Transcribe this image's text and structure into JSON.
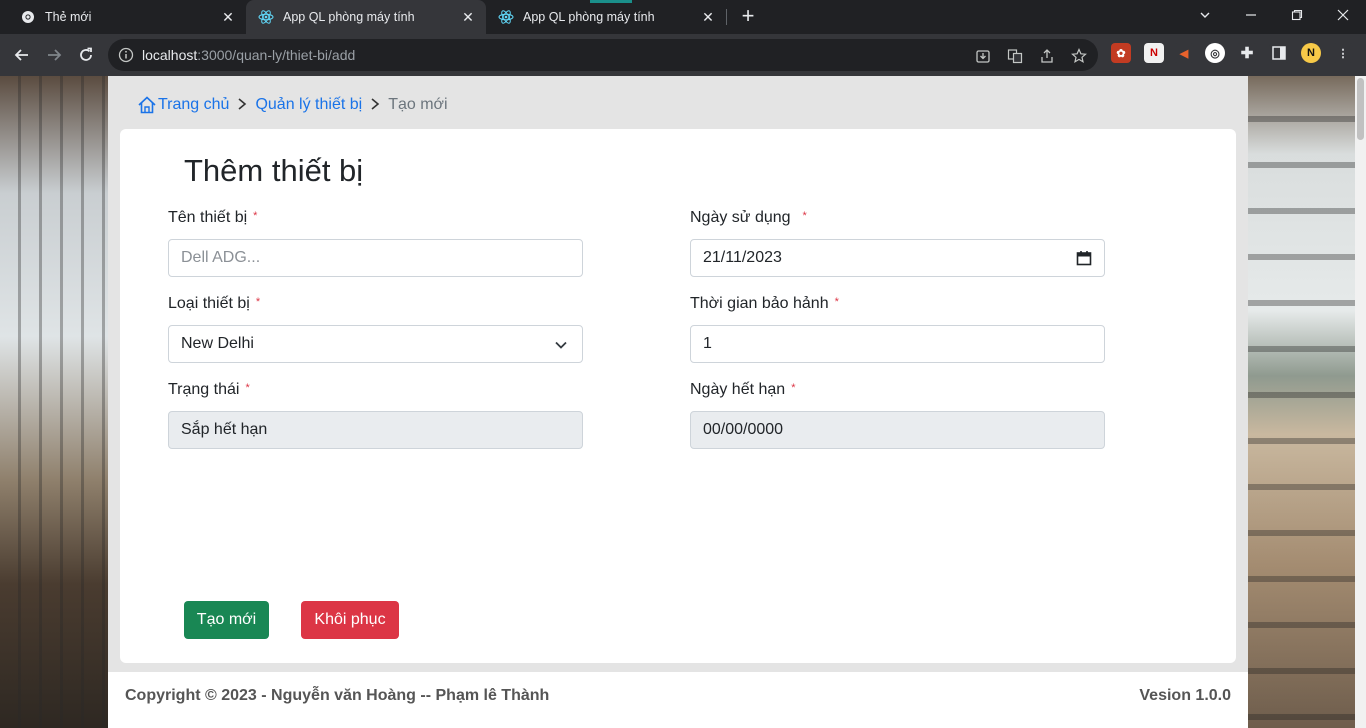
{
  "browser": {
    "tabs": [
      {
        "title": "Thẻ mới",
        "icon": "chrome-icon"
      },
      {
        "title": "App QL phòng máy tính",
        "icon": "react-icon",
        "active": true
      },
      {
        "title": "App QL phòng máy tính",
        "icon": "react-icon"
      }
    ],
    "url_host": "localhost",
    "url_rest": ":3000/quan-ly/thiet-bi/add"
  },
  "breadcrumb": {
    "home": "Trang chủ",
    "section": "Quản lý thiết bị",
    "current": "Tạo mới"
  },
  "form": {
    "title": "Thêm thiết bị",
    "required_mark": "*",
    "name": {
      "label": "Tên thiết bị",
      "placeholder": "Dell ADG..."
    },
    "type": {
      "label": "Loại thiết bị",
      "value": "New Delhi"
    },
    "status": {
      "label": "Trạng thái",
      "value": "Sắp hết hạn"
    },
    "use_date": {
      "label": "Ngày sử dụng",
      "value": "21/11/2023"
    },
    "warranty": {
      "label": "Thời gian bảo hảnh",
      "value": "1"
    },
    "expiry": {
      "label": "Ngày hết hạn",
      "value": "00/00/0000"
    },
    "create_button": "Tạo mới",
    "reset_button": "Khôi phục"
  },
  "footer": {
    "copyright": "Copyright © 2023 - Nguyễn văn Hoàng -- Phạm lê Thành",
    "version": "Vesion 1.0.0"
  },
  "colors": {
    "link": "#1a73e8",
    "success": "#198754",
    "danger": "#dc3545"
  }
}
